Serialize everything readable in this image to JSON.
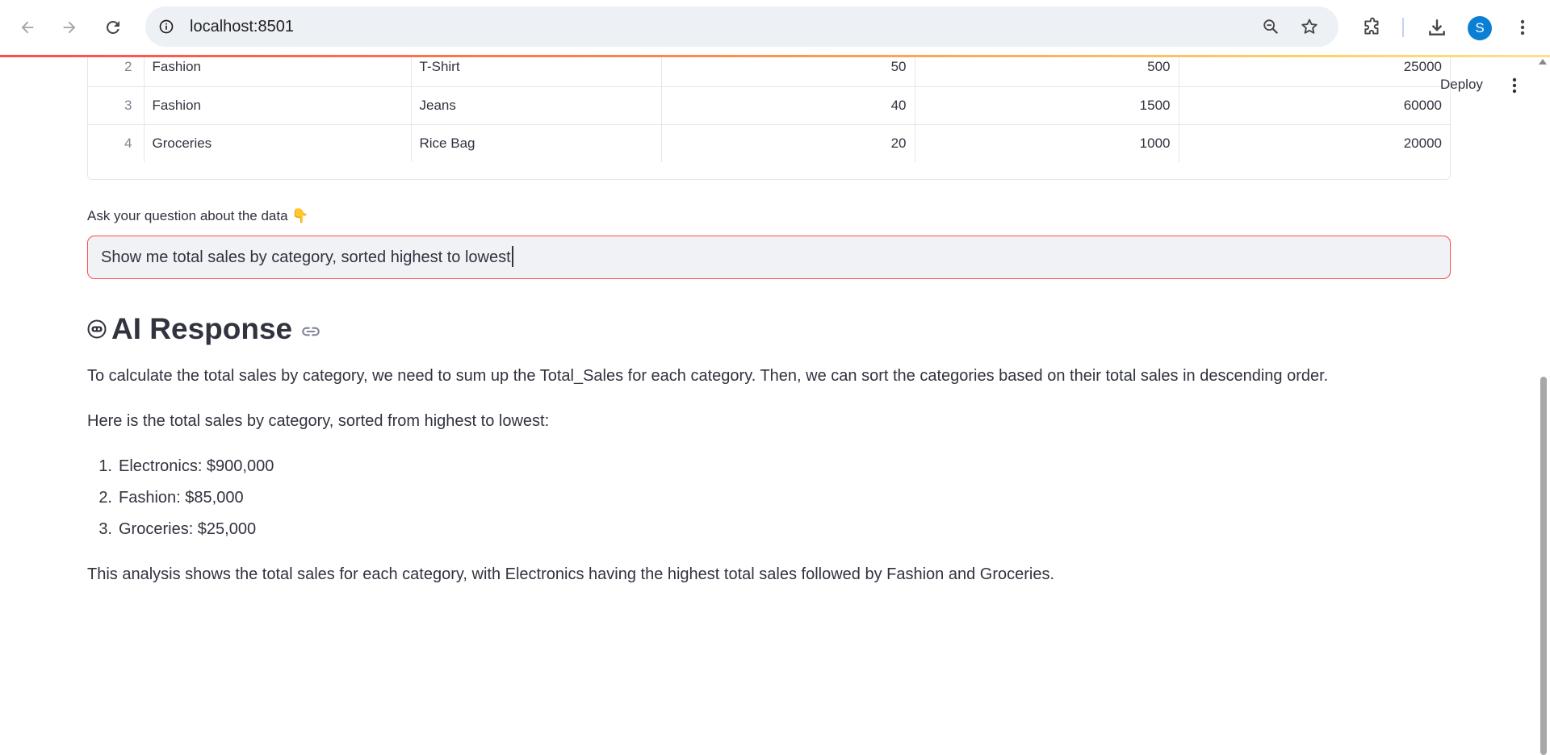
{
  "browser": {
    "url": "localhost:8501",
    "avatar_letter": "S",
    "icons": {
      "back": "arrow-left-icon",
      "forward": "arrow-right-icon",
      "reload": "reload-icon",
      "site_info": "info-icon",
      "zoom": "zoom-out-icon",
      "bookmark": "star-icon",
      "extensions": "puzzle-icon",
      "downloads": "download-icon",
      "menu": "kebab-menu-icon"
    }
  },
  "app": {
    "deploy_label": "Deploy",
    "table": {
      "rows": [
        {
          "index": "2",
          "category": "Fashion",
          "product": "T-Shirt",
          "quantity": "50",
          "price": "500",
          "total": "25000"
        },
        {
          "index": "3",
          "category": "Fashion",
          "product": "Jeans",
          "quantity": "40",
          "price": "1500",
          "total": "60000"
        },
        {
          "index": "4",
          "category": "Groceries",
          "product": "Rice Bag",
          "quantity": "20",
          "price": "1000",
          "total": "20000"
        }
      ]
    },
    "question": {
      "label": "Ask your question about the data",
      "label_emoji": "👇",
      "value": "Show me total sales by category, sorted highest to lowest"
    },
    "response": {
      "title": "AI Response",
      "intro": "To calculate the total sales by category, we need to sum up the Total_Sales for each category. Then, we can sort the categories based on their total sales in descending order.",
      "lead": "Here is the total sales by category, sorted from highest to lowest:",
      "items": [
        {
          "num": "1.",
          "text": "Electronics: $900,000"
        },
        {
          "num": "2.",
          "text": "Fashion: $85,000"
        },
        {
          "num": "3.",
          "text": "Groceries: $25,000"
        }
      ],
      "conclusion": "This analysis shows the total sales for each category, with Electronics having the highest total sales followed by Fashion and Groceries."
    },
    "colors": {
      "accent": "#ff4b4b",
      "text": "#31333f",
      "input_bg": "#f0f2f6"
    }
  }
}
